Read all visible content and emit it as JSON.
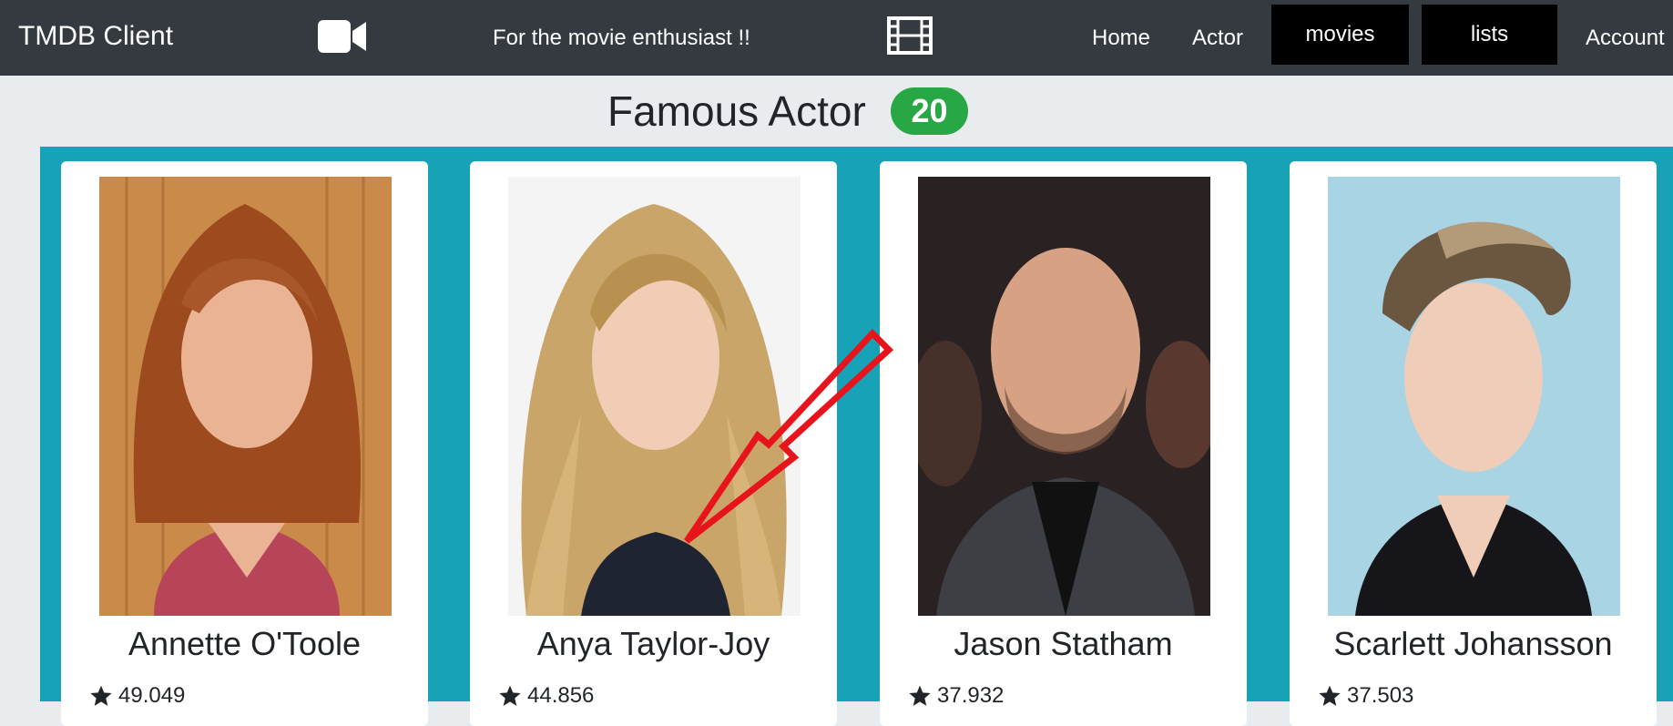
{
  "navbar": {
    "brand": "TMDB Client",
    "tagline": "For the movie enthusiast !!",
    "camera_icon": "video-camera-icon",
    "film_icon": "film-strip-icon",
    "links": {
      "home": "Home",
      "actor": "Actor",
      "movies": "movies",
      "lists": "lists",
      "account": "Account"
    }
  },
  "heading": {
    "title": "Famous Actor",
    "count": "20"
  },
  "colors": {
    "navbar": "#343a40",
    "page_background": "#e9ecef",
    "grid_background": "#17a2b8",
    "badge": "#28a745",
    "active_nav": "#000000",
    "annotation_arrow": "#e8141c"
  },
  "actors": [
    {
      "name": "Annette O'Toole",
      "rating": "49.049",
      "icon": "star-icon"
    },
    {
      "name": "Anya Taylor-Joy",
      "rating": "44.856",
      "icon": "star-icon"
    },
    {
      "name": "Jason Statham",
      "rating": "37.932",
      "icon": "star-icon"
    },
    {
      "name": "Scarlett Johansson",
      "rating": "37.503",
      "icon": "star-icon"
    }
  ]
}
